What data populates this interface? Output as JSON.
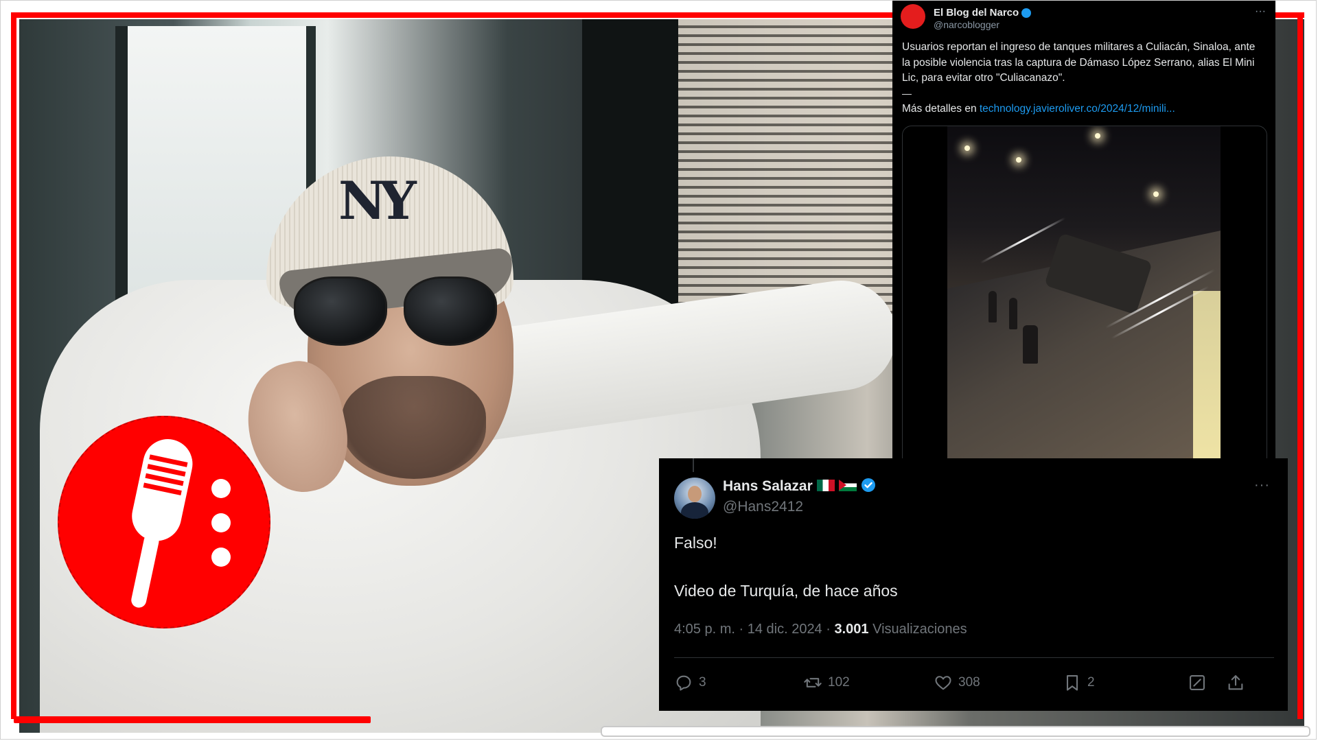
{
  "top_tweet": {
    "name": "El Blog del Narco",
    "handle": "@narcoblogger",
    "more": "···",
    "text": "Usuarios reportan el ingreso de tanques militares a Culiacán, Sinaloa, ante la posible violencia tras la captura de Dámaso López Serrano, alias El Mini Lic, para evitar otro \"Culiacanazo\".",
    "dash": "—",
    "details_prefix": "Más detalles en ",
    "details_link": "technology.javieroliver.co/2024/12/minili..."
  },
  "reply_tweet": {
    "name": "Hans Salazar",
    "handle": "@Hans2412",
    "more": "···",
    "line1": "Falso!",
    "line2": "Video de Turquía, de hace años",
    "time": "4:05 p. m. · 14 dic. 2024 · ",
    "views_count": "3.001",
    "views_label": " Visualizaciones",
    "actions": {
      "replies": "3",
      "retweets": "102",
      "likes": "308",
      "bookmarks": "2"
    },
    "flags": [
      "mexico-flag",
      "palestine-flag"
    ],
    "verified_color": "#1d9bf0"
  },
  "icons": {
    "logo": "microphone-icon",
    "reply": "reply-icon",
    "retweet": "retweet-icon",
    "like": "heart-icon",
    "bookmark": "bookmark-icon",
    "grok": "grok-icon",
    "share": "share-icon"
  },
  "colors": {
    "frame": "#ff0000",
    "tweet_bg": "#000000",
    "link": "#1d9bf0",
    "muted": "#71767b"
  }
}
